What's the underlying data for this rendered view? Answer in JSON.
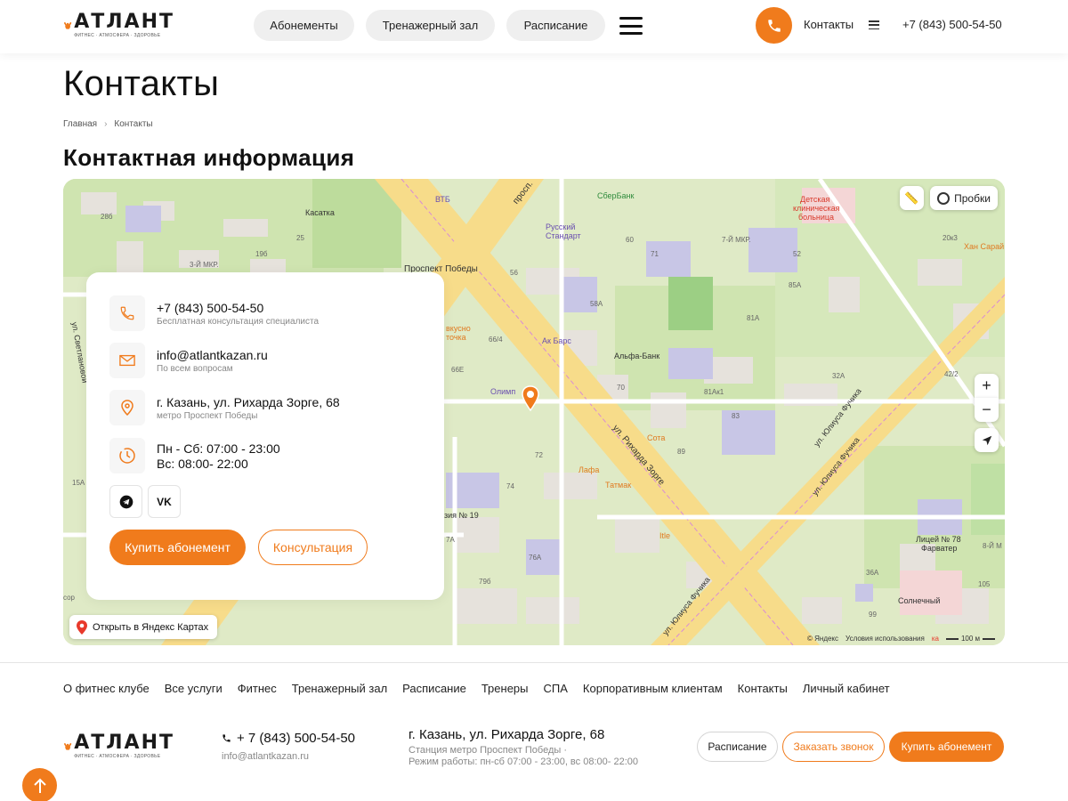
{
  "header": {
    "logo_name": "АТЛАНТ",
    "logo_tagline": "ФИТНЕС · АТМОСФЕРА · ЗДОРОВЬЕ",
    "nav": [
      "Абонементы",
      "Тренажерный зал",
      "Расписание"
    ],
    "contacts_label": "Контакты",
    "phone": "+7 (843) 500-54-50",
    "accent_color": "#f07b1c"
  },
  "page": {
    "title": "Контакты",
    "breadcrumb": [
      "Главная",
      "Контакты"
    ],
    "section_title": "Контактная информация"
  },
  "card": {
    "phone": "+7 (843) 500-54-50",
    "phone_note": "Бесплатная консультация специалиста",
    "email": "info@atlantkazan.ru",
    "email_note": "По всем вопросам",
    "address": "г. Казань, ул. Рихарда Зорге, 68",
    "address_note": "метро Проспект Победы",
    "hours_line1": "Пн - Сб: 07:00 - 23:00",
    "hours_line2": "Вс: 08:00- 22:00",
    "social_vk": "VK",
    "buy_label": "Купить абонемент",
    "consult_label": "Консультация"
  },
  "map": {
    "open_label": "Открыть в Яндекс Картах",
    "traffic_label": "Пробки",
    "zoom_in": "+",
    "zoom_out": "−",
    "copyright": "© Яндекс",
    "terms": "Условия использования",
    "scale": "100 м",
    "labels": {
      "katalka": "Касатка",
      "vtb": "ВТБ",
      "sberbank": "СберБанк",
      "pobedy": "Проспект Победы",
      "russky": "Русский",
      "standart": "Стандарт",
      "mkr7": "7-Й МКР.",
      "mkr3": "3-Й МКР.",
      "bolnica1": "Детская",
      "bolnica2": "клиническая",
      "bolnica3": "больница",
      "hansarai": "Хан Сарай",
      "ak_bars": "Ак Барс",
      "alfa": "Альфа-Банк",
      "olimp": "Олимп",
      "sota": "Сота",
      "lafa": "Лафа",
      "tatmak": "Татмак",
      "itle": "Itle",
      "vkusno1": "вкусно",
      "vkusno2": "точка",
      "zorge_street": "ул. Рихарда Зорге",
      "fuchika_street1": "ул. Юлиуса Фучика",
      "fuchika_street2": "ул. Юлиуса Фучика",
      "fuchika_street3": "ул. Юлиуса Фучика",
      "svetlaya": "ул. Светлановой",
      "licey1": "Лицей № 78",
      "licey2": "Фарватер",
      "solnechny": "Солнечный",
      "gimn": "зия № 19",
      "prosp": "просп.",
      "mkr8": "8-Й М",
      "n28b": "28б",
      "n25": "25",
      "n19b": "19б",
      "n56": "56",
      "n58a": "58А",
      "n60": "60",
      "n71": "71",
      "n85a": "85А",
      "n81a": "81А",
      "n81ak1": "81Ак1",
      "n32a": "32А",
      "n42_2": "42/2",
      "n20k3": "20к3",
      "n66_4": "66/4",
      "n66e": "66Е",
      "n72": "72",
      "n74": "74",
      "n76a": "76А",
      "n79b": "79б",
      "n89": "89",
      "n15a": "15А",
      "n7a": "7А",
      "n36a": "36А",
      "n105": "105",
      "n99": "99",
      "n52": "52",
      "n70": "70",
      "n83": "83",
      "sor": "сор",
      "ka": "ка"
    }
  },
  "footer": {
    "nav": [
      "О фитнес клубе",
      "Все услуги",
      "Фитнес",
      "Тренажерный зал",
      "Расписание",
      "Тренеры",
      "СПА",
      "Корпоративным клиентам",
      "Контакты",
      "Личный кабинет"
    ],
    "phone": "+ 7 (843) 500-54-50",
    "email": "info@atlantkazan.ru",
    "address": "г. Казань, ул. Рихарда Зорге, 68",
    "metro": "Станция метро Проспект Победы ·",
    "hours": "Режим работы: пн-сб 07:00 - 23:00, вс 08:00- 22:00",
    "schedule_btn": "Расписание",
    "callback_btn": "Заказать звонок",
    "buy_btn": "Купить абонемент"
  }
}
